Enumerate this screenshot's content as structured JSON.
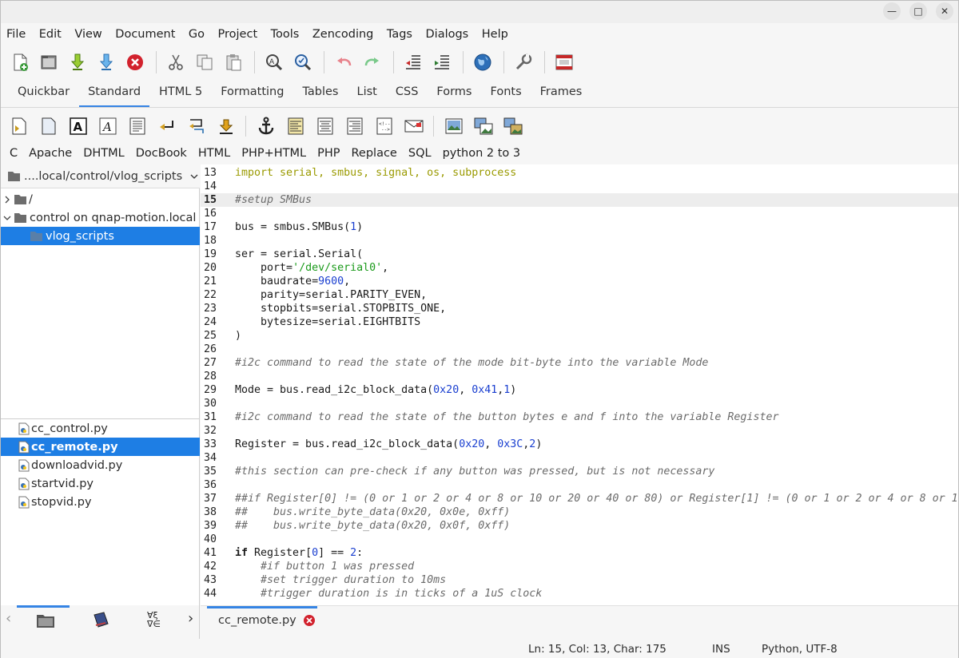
{
  "window_controls": {
    "minimize": "—",
    "maximize": "□",
    "close": "✕"
  },
  "menu": [
    "File",
    "Edit",
    "View",
    "Document",
    "Go",
    "Project",
    "Tools",
    "Zencoding",
    "Tags",
    "Dialogs",
    "Help"
  ],
  "tabs": [
    "Quickbar",
    "Standard",
    "HTML 5",
    "Formatting",
    "Tables",
    "List",
    "CSS",
    "Forms",
    "Fonts",
    "Frames"
  ],
  "active_tab": "Standard",
  "snippets": [
    "C",
    "Apache",
    "DHTML",
    "DocBook",
    "HTML",
    "PHP+HTML",
    "PHP",
    "Replace",
    "SQL",
    "python 2 to 3"
  ],
  "left_panel": {
    "path": "....local/control/vlog_scripts",
    "tree": [
      {
        "label": "/",
        "expanded": false
      },
      {
        "label": "control on qnap-motion.local",
        "expanded": true
      },
      {
        "label": "vlog_scripts",
        "selected": true
      }
    ],
    "files": [
      {
        "name": "cc_control.py"
      },
      {
        "name": "cc_remote.py",
        "selected": true
      },
      {
        "name": "downloadvid.py"
      },
      {
        "name": "startvid.py"
      },
      {
        "name": "stopvid.py"
      }
    ],
    "chevrons": {
      "left": "‹",
      "right": "›"
    },
    "bottom_icons": [
      "folder-icon",
      "bookmark-icon",
      "char-map-icon"
    ]
  },
  "editor": {
    "current_line": 15,
    "lines": [
      {
        "n": "13",
        "t": "import serial, smbus, signal, os, subprocess"
      },
      {
        "n": "14",
        "t": ""
      },
      {
        "n": "15",
        "t": "#setup SMBus"
      },
      {
        "n": "16",
        "t": ""
      },
      {
        "n": "17",
        "t": "bus = smbus.SMBus(1)"
      },
      {
        "n": "18",
        "t": ""
      },
      {
        "n": "19",
        "t": "ser = serial.Serial("
      },
      {
        "n": "20",
        "t": "    port='/dev/serial0',"
      },
      {
        "n": "21",
        "t": "    baudrate=9600,"
      },
      {
        "n": "22",
        "t": "    parity=serial.PARITY_EVEN,"
      },
      {
        "n": "23",
        "t": "    stopbits=serial.STOPBITS_ONE,"
      },
      {
        "n": "24",
        "t": "    bytesize=serial.EIGHTBITS"
      },
      {
        "n": "25",
        "t": ")"
      },
      {
        "n": "26",
        "t": ""
      },
      {
        "n": "27",
        "t": "#i2c command to read the state of the mode bit-byte into the variable Mode"
      },
      {
        "n": "28",
        "t": ""
      },
      {
        "n": "29",
        "t": "Mode = bus.read_i2c_block_data(0x20, 0x41,1)"
      },
      {
        "n": "30",
        "t": ""
      },
      {
        "n": "31",
        "t": "#i2c command to read the state of the button bytes e and f into the variable Register"
      },
      {
        "n": "32",
        "t": ""
      },
      {
        "n": "33",
        "t": "Register = bus.read_i2c_block_data(0x20, 0x3C,2)"
      },
      {
        "n": "34",
        "t": ""
      },
      {
        "n": "35",
        "t": "#this section can pre-check if any button was pressed, but is not necessary"
      },
      {
        "n": "36",
        "t": ""
      },
      {
        "n": "37",
        "t": "##if Register[0] != (0 or 1 or 2 or 4 or 8 or 10 or 20 or 40 or 80) or Register[1] != (0 or 1 or 2 or 4 or 8 or 1"
      },
      {
        "n": "38",
        "t": "##    bus.write_byte_data(0x20, 0x0e, 0xff)"
      },
      {
        "n": "39",
        "t": "##    bus.write_byte_data(0x20, 0x0f, 0xff)"
      },
      {
        "n": "40",
        "t": ""
      },
      {
        "n": "41",
        "t": "if Register[0] == 2:"
      },
      {
        "n": "42",
        "t": "    #if button 1 was pressed"
      },
      {
        "n": "43",
        "t": "    #set trigger duration to 10ms"
      },
      {
        "n": "44",
        "t": "    #trigger duration is in ticks of a 1uS clock"
      }
    ]
  },
  "doc_tab": {
    "name": "cc_remote.py"
  },
  "status": {
    "position": "Ln: 15, Col: 13, Char: 175",
    "mode": "INS",
    "lang": "Python, UTF-8"
  }
}
